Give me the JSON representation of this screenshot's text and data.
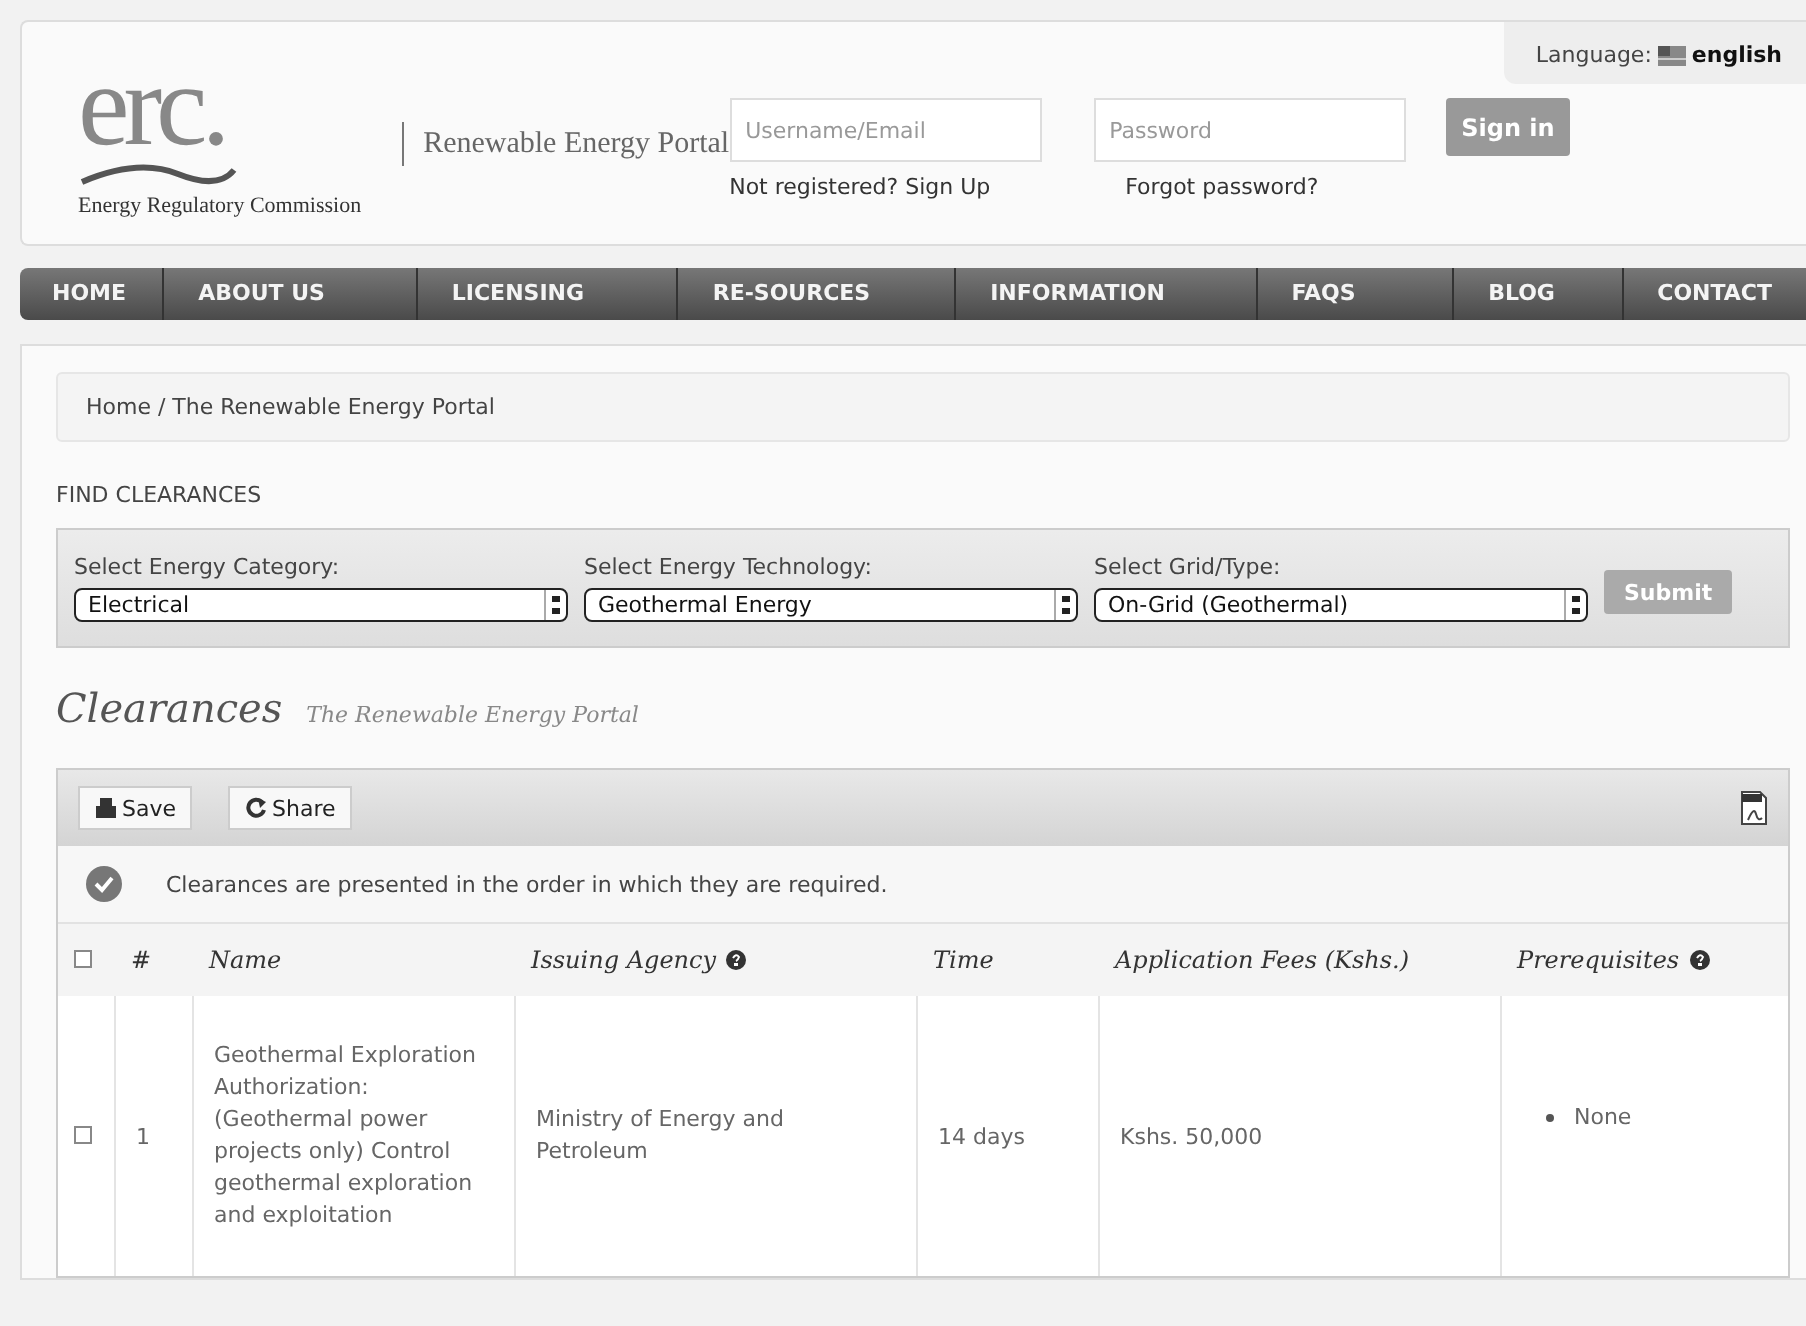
{
  "header": {
    "logo_text": "erc.",
    "logo_caption": "Energy Regulatory Commission",
    "site_title": "Renewable Energy Portal",
    "language_label": "Language:",
    "language": "english",
    "username": {
      "placeholder": "Username/Email"
    },
    "password": {
      "placeholder": "Password"
    },
    "signup_link": "Not registered? Sign Up",
    "forgot_link": "Forgot password?",
    "signin_button": "Sign in"
  },
  "nav": [
    {
      "label": "HOME",
      "selected": false
    },
    {
      "label": "ABOUT US",
      "selected": false
    },
    {
      "label": "LICENSING",
      "selected": false
    },
    {
      "label": "RE-SOURCES",
      "selected": false
    },
    {
      "label": "INFORMATION",
      "selected": false
    },
    {
      "label": "FAQS",
      "selected": false
    },
    {
      "label": "BLOG",
      "selected": false
    },
    {
      "label": "CONTACT",
      "selected": false
    }
  ],
  "breadcrumb": "Home / The Renewable Energy Portal",
  "find_title": "FIND CLEARANCES",
  "filters": [
    {
      "label": "Select Energy Category:",
      "value": "Electrical"
    },
    {
      "label": "Select Energy Technology:",
      "value": "Geothermal Energy"
    },
    {
      "label": "Select Grid/Type:",
      "value": "On-Grid (Geothermal)"
    }
  ],
  "submit_button": "Submit",
  "heading": "Clearances",
  "subheading": "The Renewable Energy Portal",
  "toolbar": [
    "Save",
    "Share"
  ],
  "notice": "Clearances are presented in the order in which they are required.",
  "table": {
    "select_all": {
      "checked": false
    },
    "columns": [
      {
        "label": "#",
        "help": false
      },
      {
        "label": "Name",
        "help": false
      },
      {
        "label": "Issuing Agency",
        "help": true
      },
      {
        "label": "Time",
        "help": false
      },
      {
        "label": "Application Fees (Kshs.)",
        "help": false
      },
      {
        "label": "Prerequisites",
        "help": true
      }
    ],
    "rows": [
      {
        "checked": false,
        "number": "1",
        "name": "Geothermal Exploration Authorization: (Geothermal power projects only) Control geothermal exploration and exploitation",
        "agency": "Ministry of Energy and Petroleum",
        "time": "14 days",
        "fees": "Kshs. 50,000",
        "prerequisites": [
          "None"
        ]
      }
    ]
  }
}
